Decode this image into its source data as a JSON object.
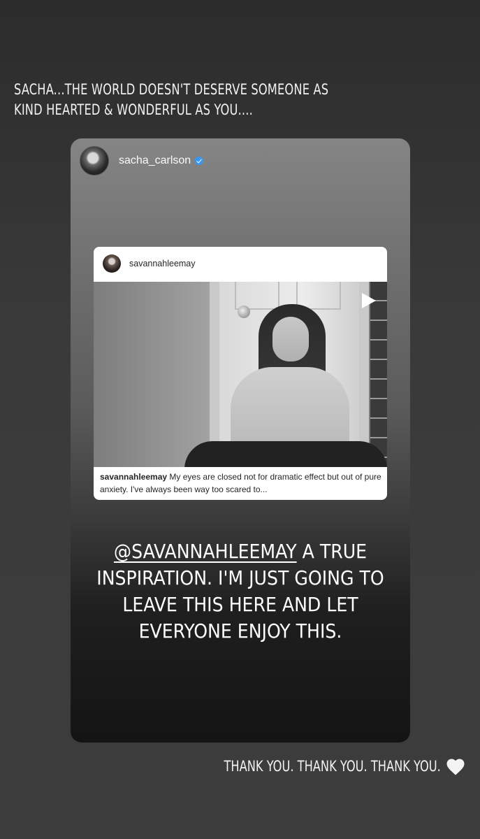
{
  "story": {
    "top_caption_line1": "SACHA...THE WORLD DOESN'T DESERVE SOMEONE AS",
    "top_caption_line2": "KIND HEARTED & WONDERFUL AS YOU....",
    "bottom_caption": "THANK YOU. THANK YOU. THANK YOU.",
    "heart_icon": "white-heart-icon"
  },
  "shared_story": {
    "username": "sacha_carlson",
    "verified": true,
    "verified_color": "#3897f0",
    "post": {
      "username": "savannahleemay",
      "caption_username": "savannahleemay",
      "caption_text": "My eyes are closed not for dramatic effect but out of pure anxiety. I've always been way too scared to...",
      "media_icon": "play-icon"
    },
    "text_mention": "@SAVANNAHLEEMAY",
    "text_rest": " A TRUE INSPIRATION. I'M JUST GOING TO LEAVE THIS HERE AND LET EVERYONE ENJOY THIS."
  }
}
